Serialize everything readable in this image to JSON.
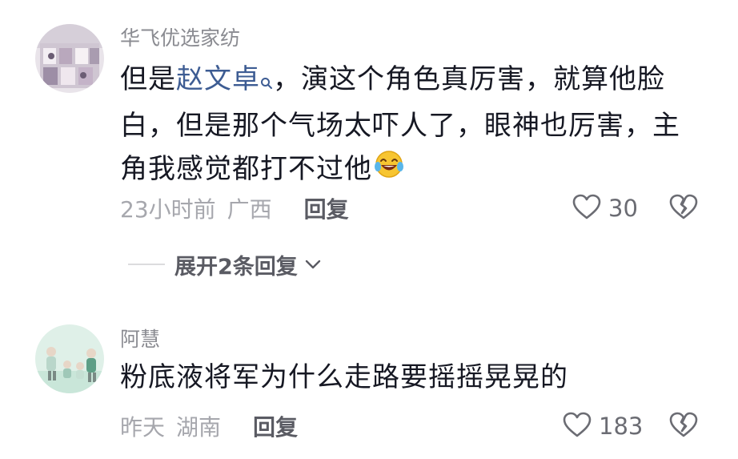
{
  "comments": [
    {
      "username": "华飞优选家纺",
      "text_before": "但是",
      "mention": "赵文卓",
      "text_after_line1": "，演这个角色真厉害，就算他脸",
      "text_line2": "白，但是那个气场太吓人了，眼神也厉害，主",
      "text_line3": "角我感觉都打不过他",
      "emoji": "laugh-tears-emoji",
      "time": "23小时前",
      "location": "广西",
      "reply_label": "回复",
      "likes": "30",
      "expand_label": "展开2条回复"
    },
    {
      "username": "阿慧",
      "text": "粉底液将军为什么走路要摇摇晃晃的",
      "time": "昨天",
      "location": "湖南",
      "reply_label": "回复",
      "likes": "183"
    }
  ],
  "colors": {
    "username": "#8a8b91",
    "body": "#161823",
    "mention": "#3d5c93",
    "meta": "#a6a7ad",
    "action": "#5a5b63"
  },
  "icons": [
    "heart-outline-icon",
    "broken-heart-icon",
    "search-icon",
    "chevron-down-icon"
  ]
}
